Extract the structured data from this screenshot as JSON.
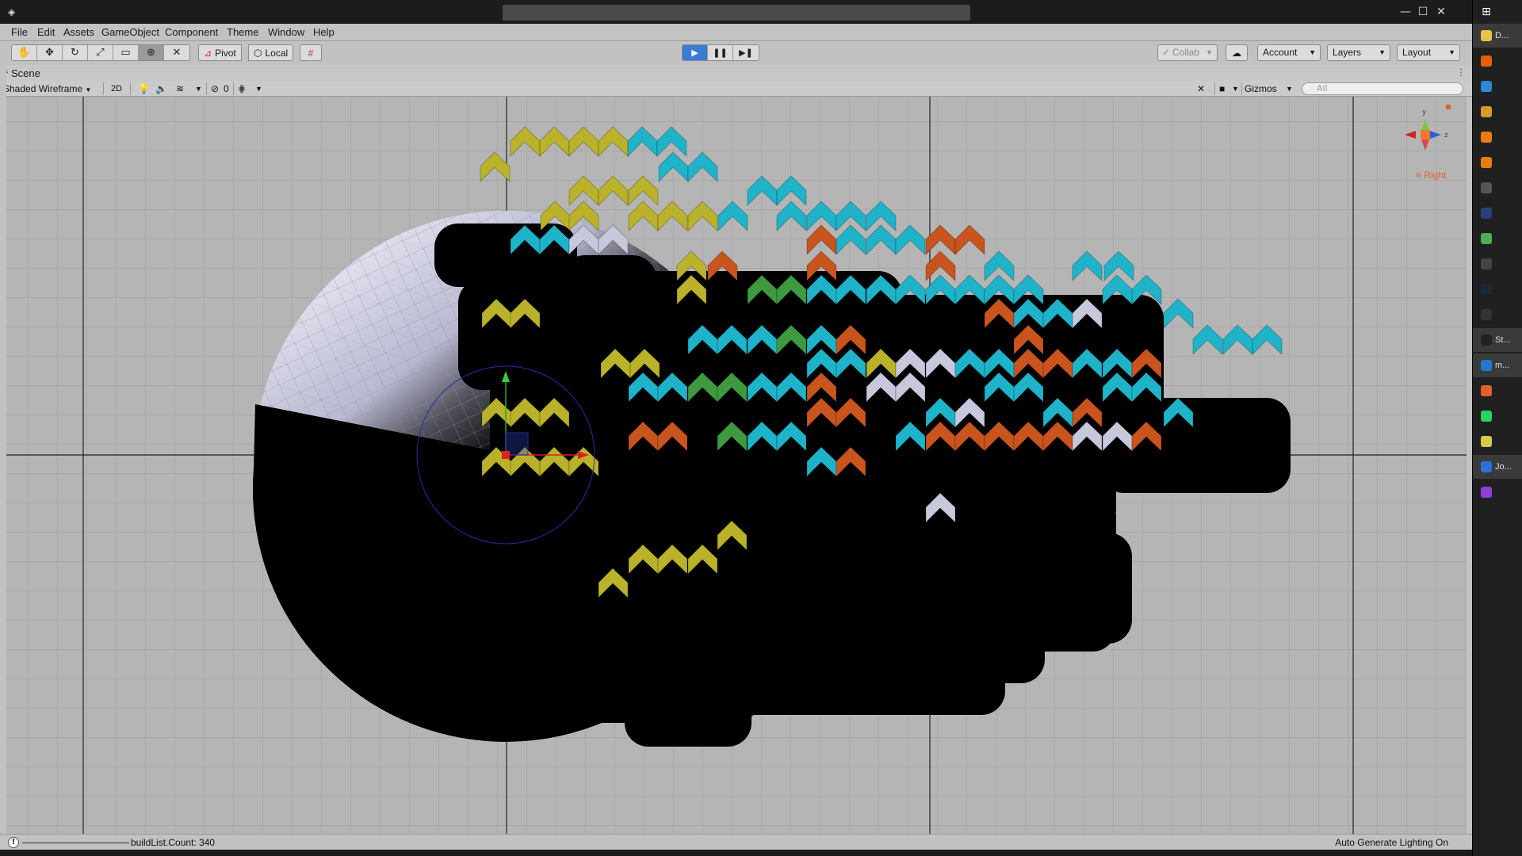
{
  "window": {
    "minimize": "—",
    "maximize": "☐",
    "close": "✕"
  },
  "menu": [
    "File",
    "Edit",
    "Assets",
    "GameObject",
    "Component",
    "Theme",
    "Window",
    "Help"
  ],
  "toolbar": {
    "tools": [
      "hand-tool",
      "move-tool",
      "rotate-tool",
      "scale-tool",
      "rect-tool",
      "transform-tool",
      "custom-tool"
    ],
    "pivot": "Pivot",
    "local": "Local",
    "collab": "Collab",
    "account": "Account",
    "layers": "Layers",
    "layout": "Layout"
  },
  "scene": {
    "tab": "Scene",
    "draw_mode": "Shaded Wireframe",
    "mode_2d": "2D",
    "hidden_count": "0",
    "gizmos": "Gizmos",
    "search_placeholder": "All",
    "view_label": "Right"
  },
  "status": {
    "message": "buildList.Count: 340",
    "lighting": "Auto Generate Lighting On"
  },
  "taskbar": [
    {
      "icon": "folder-icon",
      "label": "D...",
      "color": "#e8c34a",
      "running": true
    },
    {
      "icon": "firefox-icon",
      "label": "",
      "color": "#e66000",
      "running": false
    },
    {
      "icon": "store-icon",
      "label": "",
      "color": "#2b88d8",
      "running": false
    },
    {
      "icon": "edit-icon",
      "label": "",
      "color": "#d89b2b",
      "running": false
    },
    {
      "icon": "blender-icon",
      "label": "",
      "color": "#e87d0d",
      "running": false
    },
    {
      "icon": "blender-icon",
      "label": "",
      "color": "#e87d0d",
      "running": false
    },
    {
      "icon": "sync-icon",
      "label": "",
      "color": "#555555",
      "running": false
    },
    {
      "icon": "photoshop-icon",
      "label": "",
      "color": "#2a3f7a",
      "running": false
    },
    {
      "icon": "chrome-icon",
      "label": "",
      "color": "#4caf50",
      "running": false
    },
    {
      "icon": "obs-icon",
      "label": "",
      "color": "#444444",
      "running": false
    },
    {
      "icon": "steam-icon",
      "label": "",
      "color": "#1b2838",
      "running": false
    },
    {
      "icon": "github-icon",
      "label": "",
      "color": "#333333",
      "running": false
    },
    {
      "icon": "unity-icon",
      "label": "St...",
      "color": "#222222",
      "running": true
    },
    {
      "icon": "vscode-icon",
      "label": "m...",
      "color": "#1f7acc",
      "running": true
    },
    {
      "icon": "settings-icon",
      "label": "",
      "color": "#e0622a",
      "running": false
    },
    {
      "icon": "whatsapp-icon",
      "label": "",
      "color": "#25d366",
      "running": false
    },
    {
      "icon": "notepad-icon",
      "label": "",
      "color": "#d8c84a",
      "running": false
    },
    {
      "icon": "jetbrains-icon",
      "label": "Jo...",
      "color": "#2b6fd8",
      "running": true
    },
    {
      "icon": "app-icon",
      "label": "",
      "color": "#8a3fd8",
      "running": false
    }
  ]
}
